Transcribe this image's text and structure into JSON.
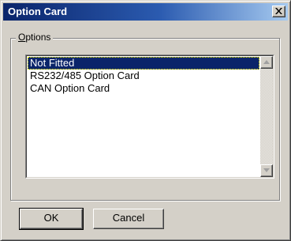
{
  "window": {
    "title": "Option Card",
    "close_icon": "close-icon"
  },
  "group": {
    "legend_mnemonic": "O",
    "legend_rest": "ptions"
  },
  "list": {
    "items": [
      {
        "label": "Not Fitted",
        "selected": true
      },
      {
        "label": "RS232/485 Option Card",
        "selected": false
      },
      {
        "label": "CAN Option Card",
        "selected": false
      }
    ],
    "scroll_up_icon": "arrow-up-icon",
    "scroll_down_icon": "arrow-down-icon"
  },
  "buttons": {
    "ok": "OK",
    "cancel": "Cancel"
  },
  "colors": {
    "title_gradient_start": "#0a246a",
    "title_gradient_end": "#a6caf0",
    "selection": "#0a246a",
    "face": "#d4d0c8"
  }
}
